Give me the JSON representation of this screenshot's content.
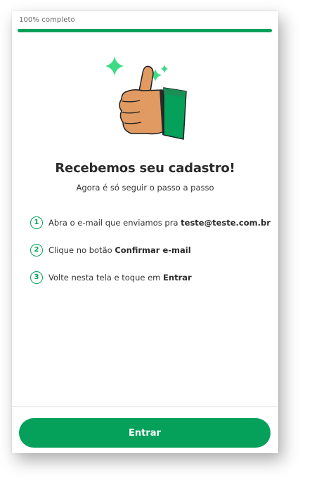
{
  "progress": {
    "label": "100% completo",
    "fraction": 1.0
  },
  "illustration": {
    "icon": "thumbs-up-icon",
    "sparkle_color": "#3ddc84",
    "sleeve_color": "#05a05a",
    "hand_color": "#e09a62"
  },
  "heading": {
    "title": "Recebemos seu cadastro!",
    "subtitle": "Agora é só seguir o passo a passo"
  },
  "steps": [
    {
      "number": "1",
      "text": "Abra o e-mail que enviamos pra ",
      "bold": "teste@teste.com.br"
    },
    {
      "number": "2",
      "text": "Clique no botão ",
      "bold": "Confirmar e-mail"
    },
    {
      "number": "3",
      "text": "Volte nesta tela e toque em ",
      "bold": "Entrar"
    }
  ],
  "footer": {
    "button_label": "Entrar"
  },
  "colors": {
    "accent": "#05a05a",
    "text": "#2b2b2b"
  }
}
